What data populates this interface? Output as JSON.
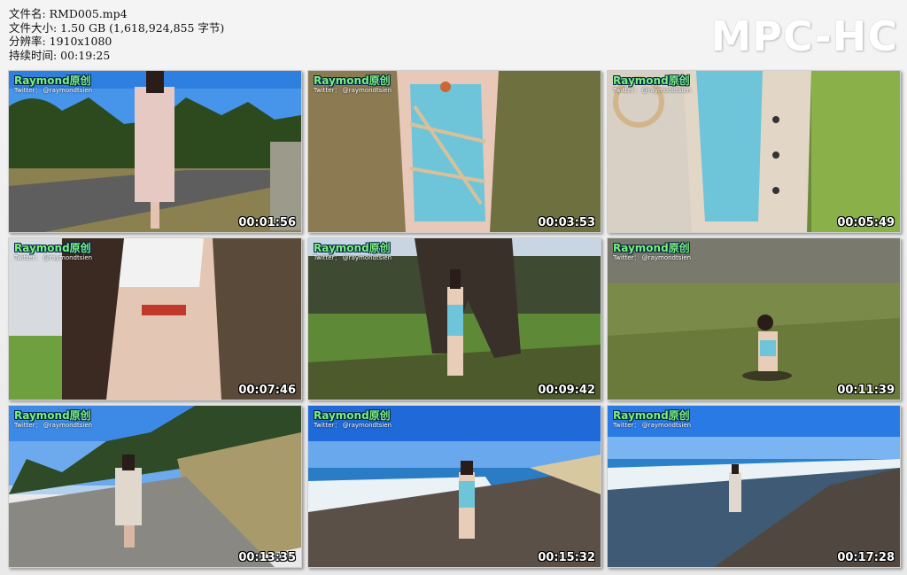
{
  "file_info": {
    "name": "文件名: RMD005.mp4",
    "size": "文件大小: 1.50 GB (1,618,924,855 字节)",
    "resolution": "分辨率: 1910x1080",
    "duration": "持续时间: 00:19:25"
  },
  "logo": "MPC-HC",
  "watermark": {
    "title": "Raymond原创",
    "subtitle": "Twitter：  @raymondtsien"
  },
  "thumbnails": [
    {
      "time": "00:01:56",
      "scene": "road-trees"
    },
    {
      "time": "00:03:53",
      "scene": "grass-closeup"
    },
    {
      "time": "00:05:49",
      "scene": "coat-closeup"
    },
    {
      "time": "00:07:46",
      "scene": "tree-closeup"
    },
    {
      "time": "00:09:42",
      "scene": "tree-park"
    },
    {
      "time": "00:11:39",
      "scene": "field"
    },
    {
      "time": "00:13:35",
      "scene": "sand-path"
    },
    {
      "time": "00:15:32",
      "scene": "beach"
    },
    {
      "time": "00:17:28",
      "scene": "beach-far"
    }
  ]
}
